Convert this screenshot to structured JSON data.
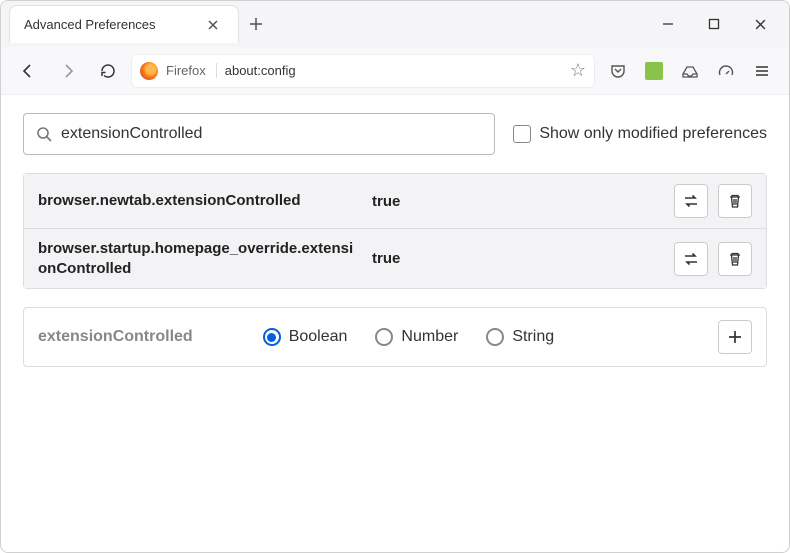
{
  "titlebar": {
    "tab_title": "Advanced Preferences"
  },
  "toolbar": {
    "identity_label": "Firefox",
    "url": "about:config"
  },
  "search": {
    "value": "extensionControlled",
    "modified_only_label": "Show only modified preferences"
  },
  "prefs": [
    {
      "name": "browser.newtab.extensionControlled",
      "value": "true"
    },
    {
      "name": "browser.startup.homepage_override.extensionControlled",
      "value": "true"
    }
  ],
  "new_pref": {
    "name": "extensionControlled",
    "types": [
      "Boolean",
      "Number",
      "String"
    ],
    "selected": "Boolean"
  }
}
